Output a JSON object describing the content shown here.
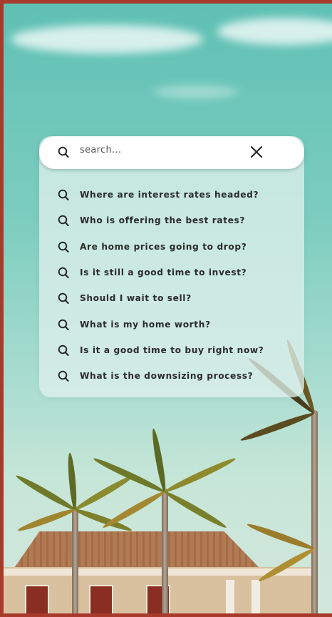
{
  "search": {
    "placeholder": "search...",
    "search_icon": "search-icon",
    "close_icon": "close-icon"
  },
  "suggestions": [
    {
      "label": "Where are interest rates headed?",
      "icon": "search-icon"
    },
    {
      "label": "Who is offering the best rates?",
      "icon": "search-icon"
    },
    {
      "label": "Are home prices going to drop?",
      "icon": "search-icon"
    },
    {
      "label": "Is it still a good time to invest?",
      "icon": "search-icon"
    },
    {
      "label": "Should I wait to sell?",
      "icon": "search-icon"
    },
    {
      "label": "What is my home worth?",
      "icon": "search-icon"
    },
    {
      "label": "Is it a good time to buy right now?",
      "icon": "search-icon"
    },
    {
      "label": "What is the downsizing process?",
      "icon": "search-icon"
    }
  ],
  "colors": {
    "frame": "#a83a2c",
    "sky": "#5fc0b4",
    "card": "#def0ea",
    "text": "#2b2b2b"
  }
}
